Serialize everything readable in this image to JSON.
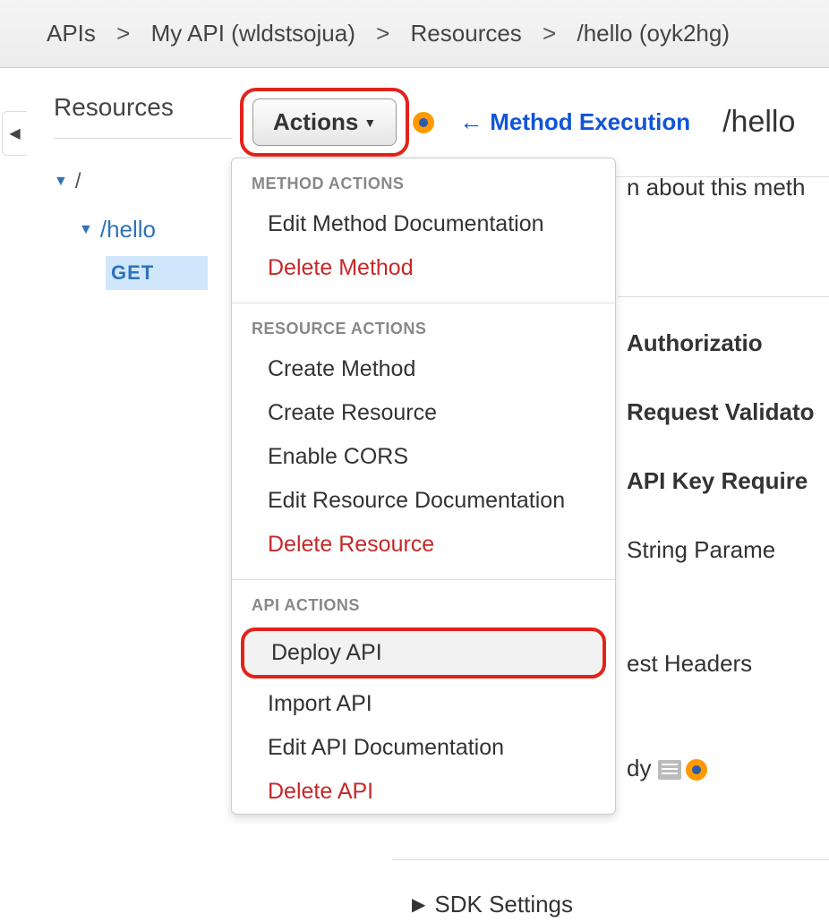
{
  "breadcrumb": {
    "items": [
      "APIs",
      "My API (wldstsojua)",
      "Resources",
      "/hello (oyk2hg)"
    ]
  },
  "sidebar": {
    "title": "Resources",
    "root": "/",
    "child": "/hello",
    "method": "GET"
  },
  "toolbar": {
    "actions_label": "Actions",
    "method_execution": "Method Execution"
  },
  "header": {
    "path": "/hello"
  },
  "dropdown": {
    "section1_title": "METHOD ACTIONS",
    "section1_items": [
      {
        "label": "Edit Method Documentation",
        "danger": false
      },
      {
        "label": "Delete Method",
        "danger": true
      }
    ],
    "section2_title": "RESOURCE ACTIONS",
    "section2_items": [
      {
        "label": "Create Method",
        "danger": false
      },
      {
        "label": "Create Resource",
        "danger": false
      },
      {
        "label": "Enable CORS",
        "danger": false
      },
      {
        "label": "Edit Resource Documentation",
        "danger": false
      },
      {
        "label": "Delete Resource",
        "danger": true
      }
    ],
    "section3_title": "API ACTIONS",
    "section3_items": [
      {
        "label": "Deploy API",
        "danger": false,
        "highlighted": true
      },
      {
        "label": "Import API",
        "danger": false
      },
      {
        "label": "Edit API Documentation",
        "danger": false
      },
      {
        "label": "Delete API",
        "danger": true
      }
    ]
  },
  "right": {
    "info_text": "n about this meth",
    "auth_label": "Authorizatio",
    "validator_label": "Request Validato",
    "apikey_label": "API Key Require",
    "qs_label": "String Parame",
    "headers_label": "est Headers",
    "body_label": "dy"
  },
  "bottom": {
    "sdk_label": "SDK Settings"
  }
}
